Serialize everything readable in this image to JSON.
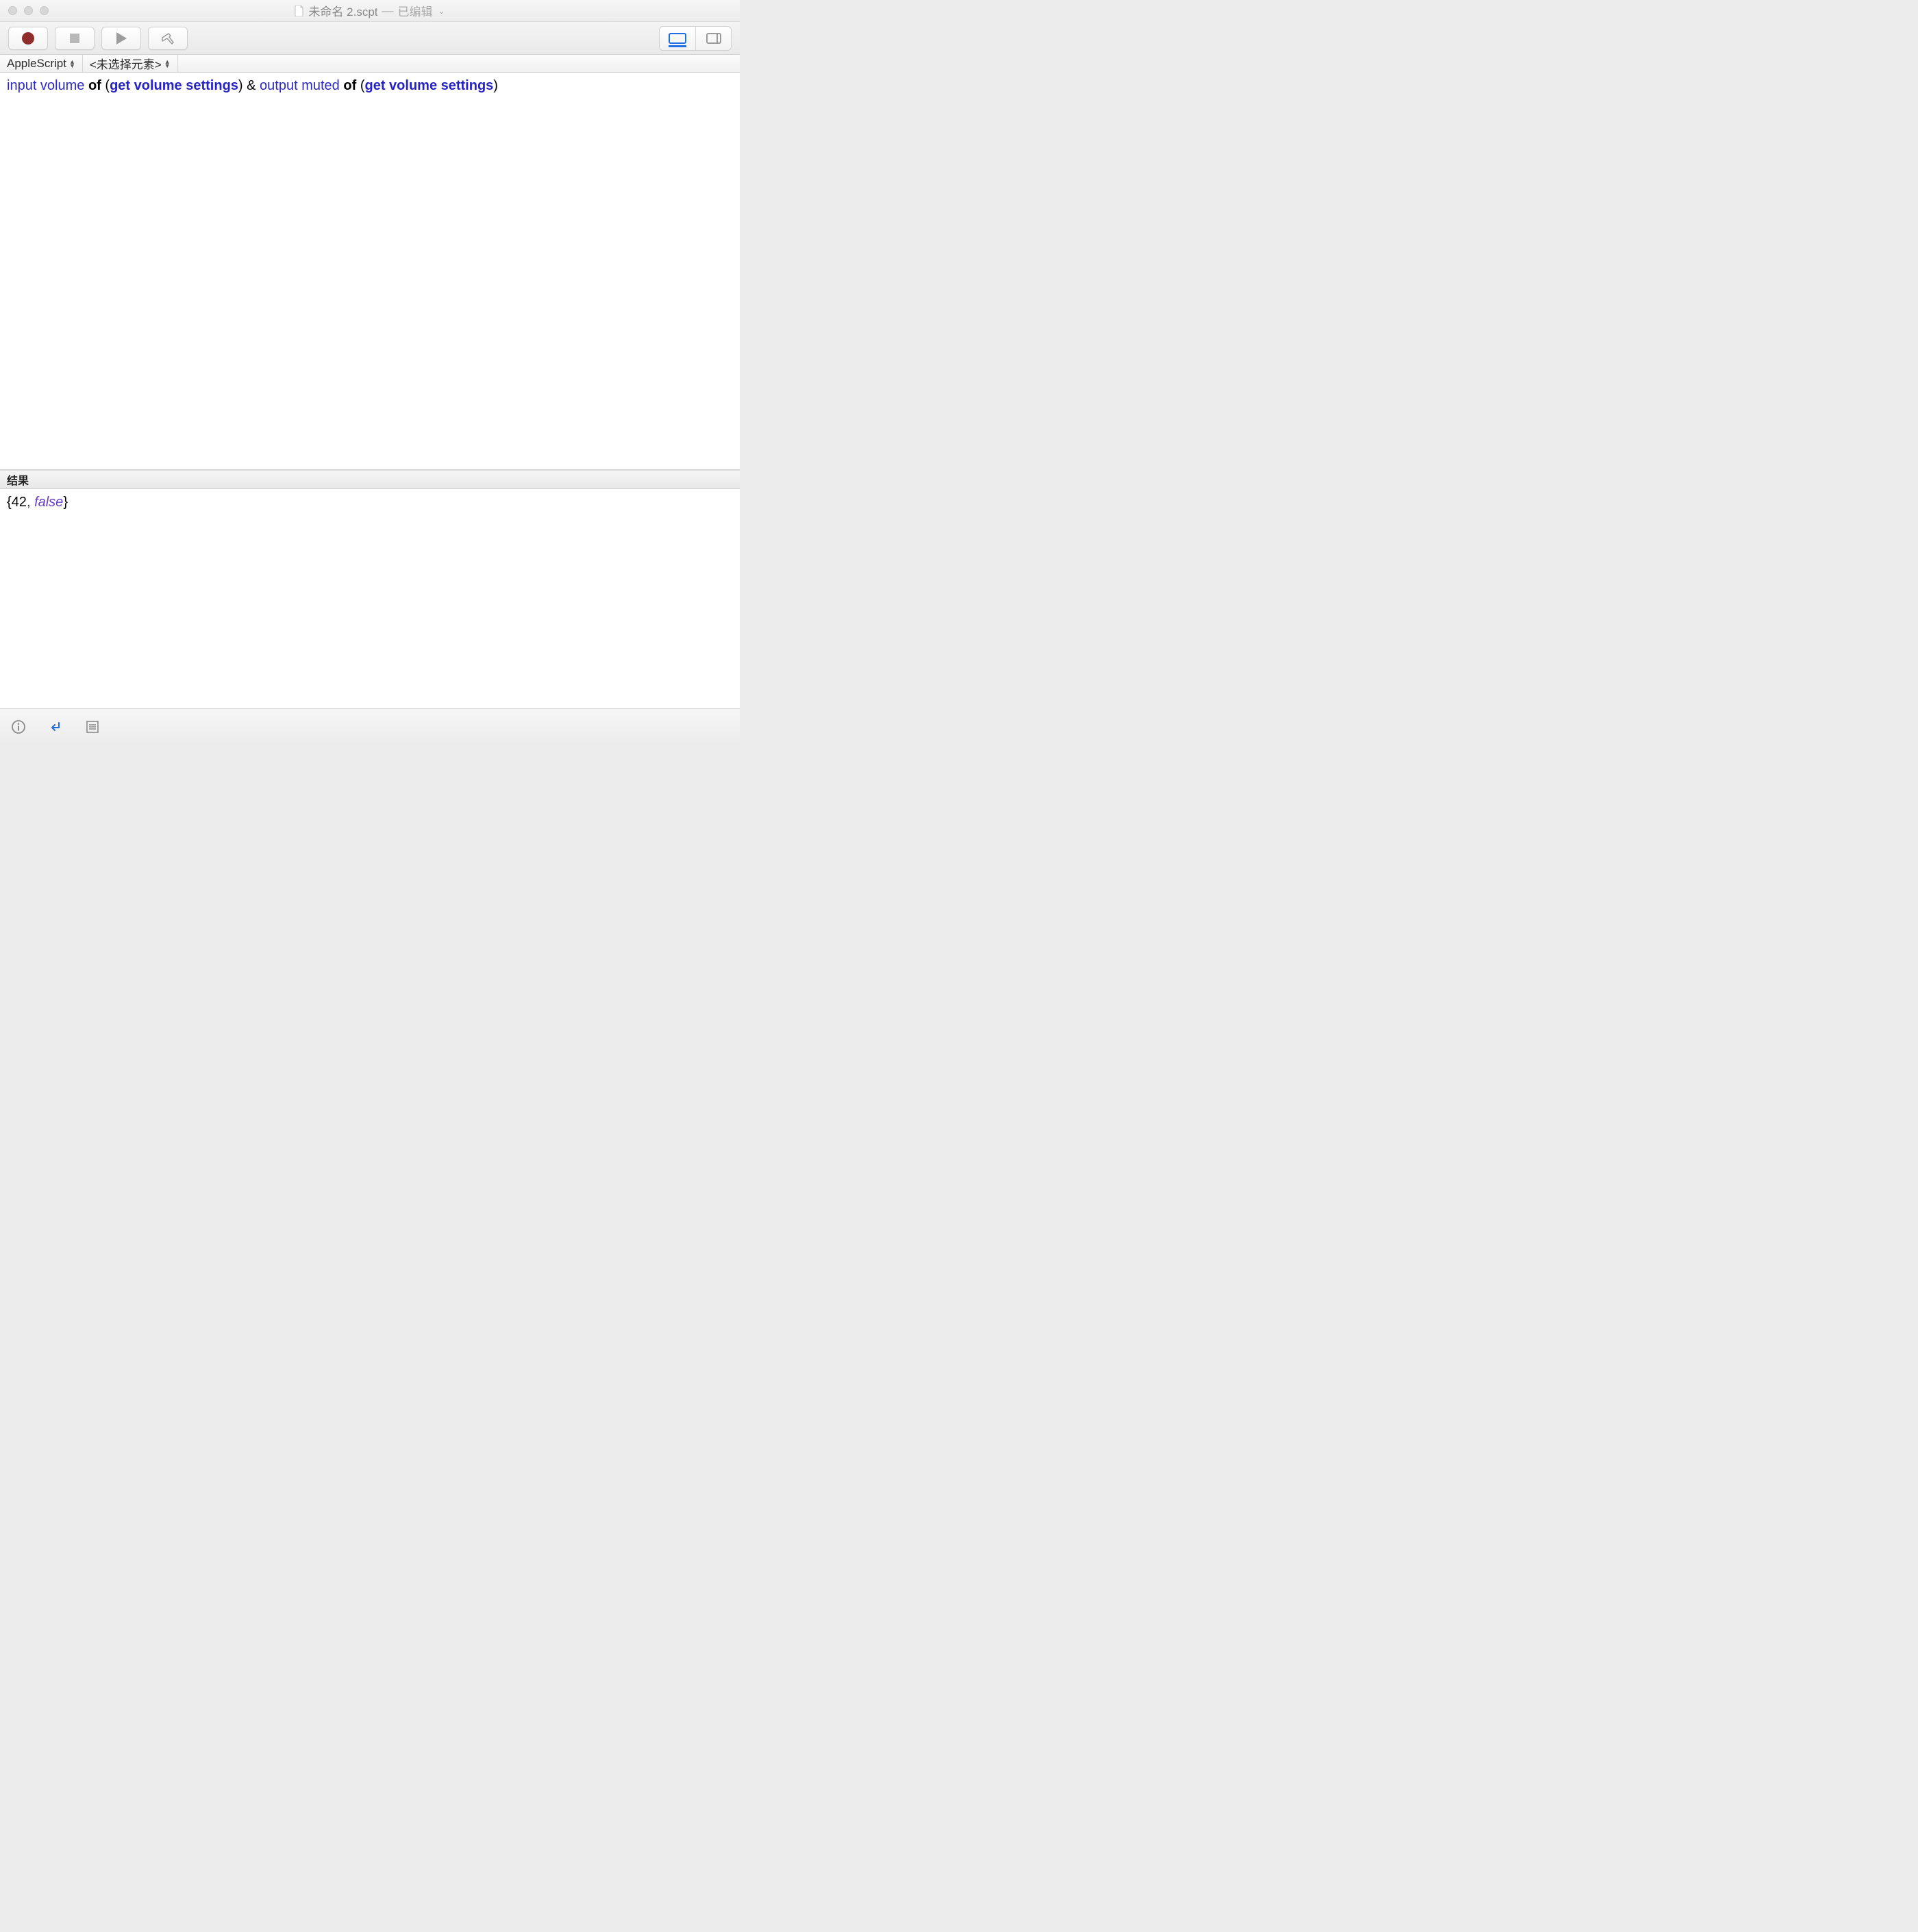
{
  "title": {
    "filename": "未命名 2.scpt",
    "separator": " — ",
    "edited": "已编辑"
  },
  "navbar": {
    "language": "AppleScript",
    "elements": "<未选择元素>"
  },
  "code": {
    "t1": "input volume",
    "t2": "of",
    "t3": "(",
    "t4": "get volume settings",
    "t5": ")",
    "t6": "&",
    "t7": "output muted",
    "t8": "of",
    "t9": "(",
    "t10": "get volume settings",
    "t11": ")"
  },
  "results": {
    "header": "结果",
    "brace_open": "{",
    "v1": "42",
    "comma": ", ",
    "v2": "false",
    "brace_close": "}"
  }
}
